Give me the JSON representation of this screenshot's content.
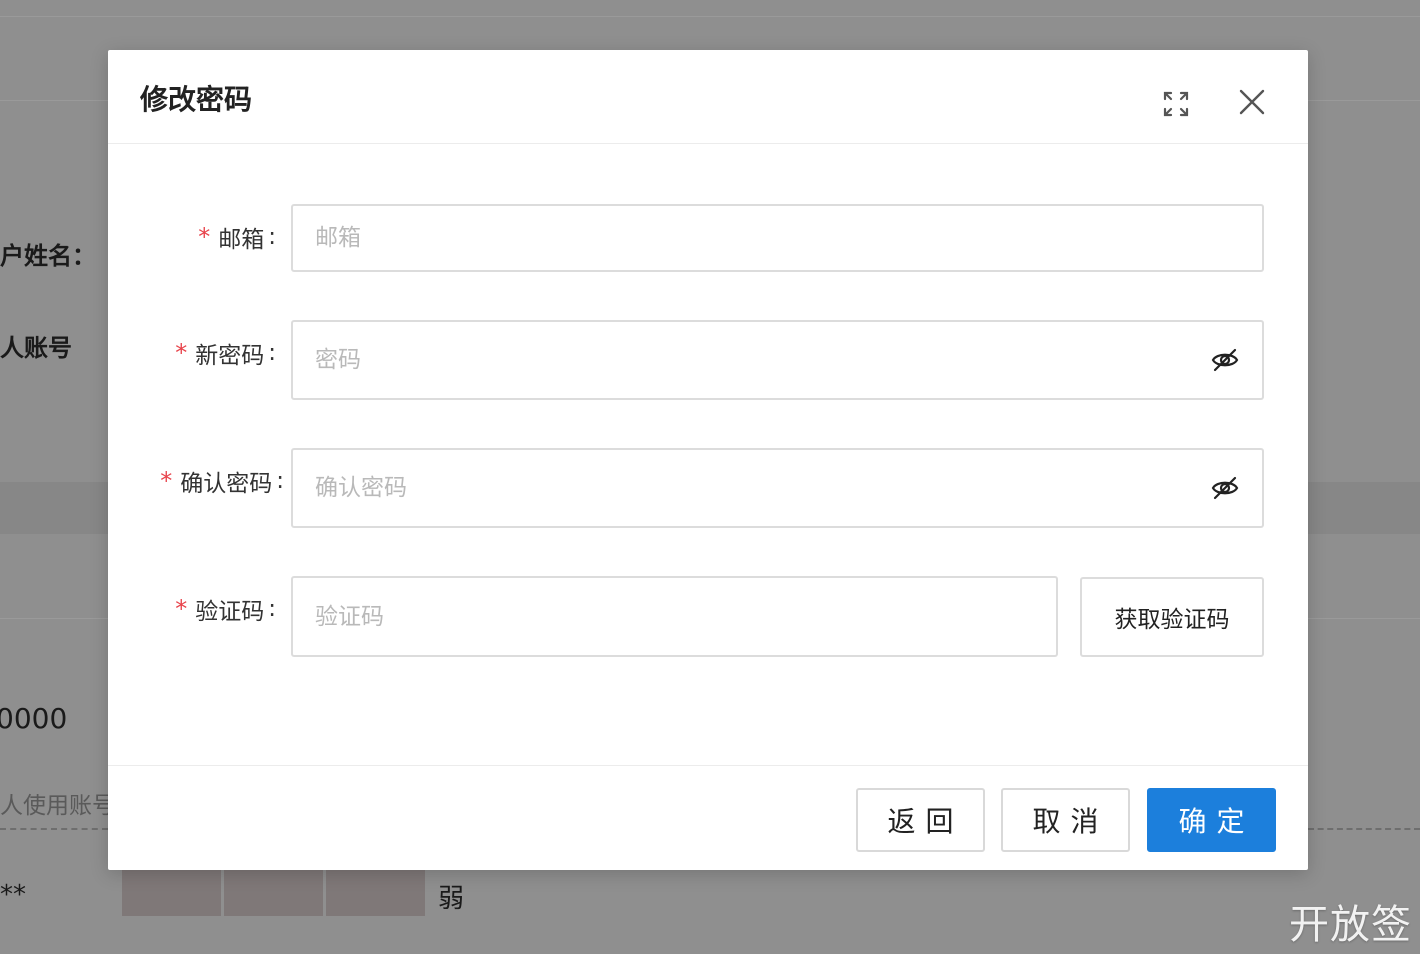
{
  "background": {
    "label_name": "户姓名：",
    "label_account": "人账号",
    "value_number": "0000",
    "hint_text": "人使用账号",
    "masked_value": "**",
    "strength_label": "弱"
  },
  "watermark": "开放签",
  "modal": {
    "title": "修改密码",
    "fields": {
      "email": {
        "label": "邮箱",
        "placeholder": "邮箱"
      },
      "new_password": {
        "label": "新密码",
        "placeholder": "密码"
      },
      "confirm_password": {
        "label": "确认密码",
        "placeholder": "确认密码"
      },
      "code": {
        "label": "验证码",
        "placeholder": "验证码",
        "button": "获取验证码"
      }
    },
    "required_mark": "*",
    "colon": ":",
    "footer": {
      "back": "返回",
      "cancel": "取消",
      "confirm": "确定"
    }
  },
  "colors": {
    "primary": "#1c7fdc",
    "required": "#e8434b",
    "overlay": "#8f8f8f"
  }
}
